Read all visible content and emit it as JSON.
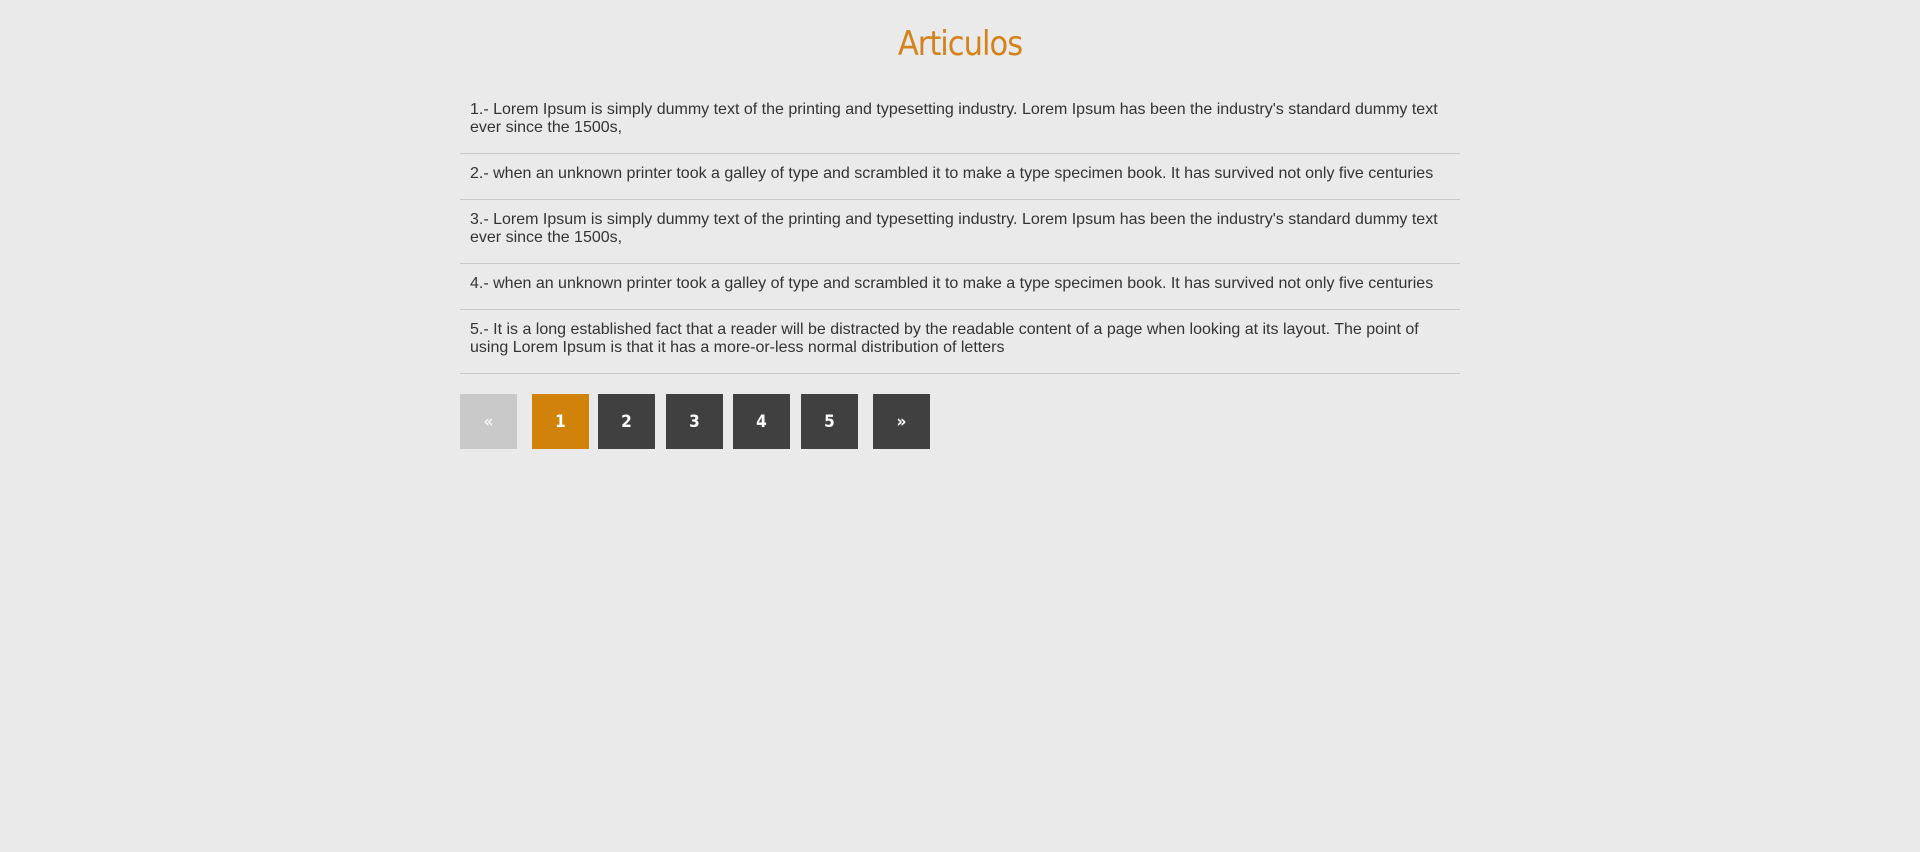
{
  "page": {
    "title": "Articulos"
  },
  "articles": [
    "1.- Lorem Ipsum is simply dummy text of the printing and typesetting industry. Lorem Ipsum has been the industry's standard dummy text ever since the 1500s,",
    "2.- when an unknown printer took a galley of type and scrambled it to make a type specimen book. It has survived not only five centuries",
    "3.- Lorem Ipsum is simply dummy text of the printing and typesetting industry. Lorem Ipsum has been the industry's standard dummy text ever since the 1500s,",
    "4.- when an unknown printer took a galley of type and scrambled it to make a type specimen book. It has survived not only five centuries",
    "5.- It is a long established fact that a reader will be distracted by the readable content of a page when looking at its layout. The point of using Lorem Ipsum is that it has a more-or-less normal distribution of letters"
  ],
  "pagination": {
    "prev_label": "«",
    "next_label": "»",
    "pages": [
      "1",
      "2",
      "3",
      "4",
      "5"
    ],
    "current_page": "1",
    "prev_disabled": true
  },
  "colors": {
    "accent": "#d4821a",
    "active_page": "#d0820a",
    "page_button": "#404040",
    "disabled_button": "#c9c9c9",
    "background": "#eaeaea"
  }
}
